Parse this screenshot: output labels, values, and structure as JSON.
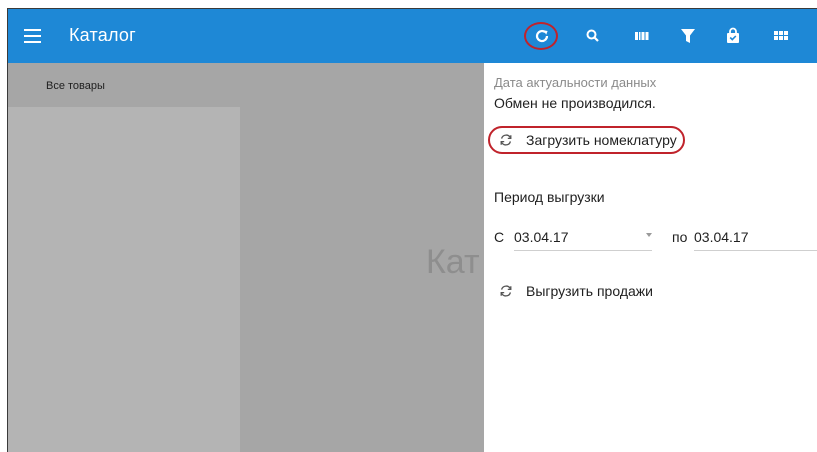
{
  "app": {
    "title": "Каталог"
  },
  "toolbar": {
    "icons": [
      "menu-icon",
      "refresh-icon",
      "search-icon",
      "barcode-icon",
      "filter-icon",
      "bag-icon",
      "grid-icon"
    ]
  },
  "catalog": {
    "all_products": "Все товары",
    "background_title": "Кат"
  },
  "sync_panel": {
    "data_date_label": "Дата актуальности данных",
    "exchange_status": "Обмен не производился.",
    "load_nomenclature": "Загрузить номеклатуру",
    "period_label": "Период выгрузки",
    "from_label": "С",
    "from_date": "03.04.17",
    "to_label": "по",
    "to_date": "03.04.17",
    "upload_sales": "Выгрузить продажи"
  },
  "colors": {
    "appbar": "#1e88d6",
    "highlight": "#c0232b",
    "overlay": "#a6a6a6"
  }
}
